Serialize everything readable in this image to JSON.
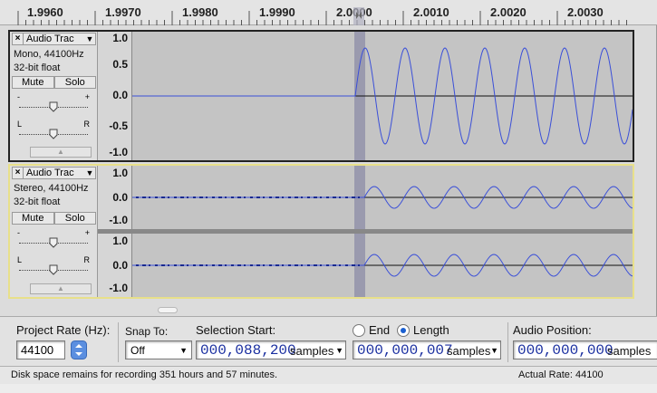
{
  "ruler": {
    "ticks": [
      "1.9960",
      "1.9970",
      "1.9980",
      "1.9990",
      "2.0000",
      "2.0010",
      "2.0020",
      "2.0030"
    ]
  },
  "tracks": [
    {
      "title": "Audio Trac",
      "format": "Mono, 44100Hz",
      "depth": "32-bit float",
      "mute_label": "Mute",
      "solo_label": "Solo",
      "gain_minus": "-",
      "gain_plus": "+",
      "pan_left": "L",
      "pan_right": "R",
      "channels": [
        {
          "ticks": [
            "1.0",
            "0.5",
            "0.0",
            "-0.5",
            "-1.0"
          ]
        }
      ]
    },
    {
      "title": "Audio Trac",
      "format": "Stereo, 44100Hz",
      "depth": "32-bit float",
      "mute_label": "Mute",
      "solo_label": "Solo",
      "gain_minus": "-",
      "gain_plus": "+",
      "pan_left": "L",
      "pan_right": "R",
      "channels": [
        {
          "ticks": [
            "1.0",
            "0.0",
            "-1.0"
          ]
        },
        {
          "ticks": [
            "1.0",
            "0.0",
            "-1.0"
          ]
        }
      ]
    }
  ],
  "selection_bar": {
    "project_rate_label": "Project Rate (Hz):",
    "project_rate_value": "44100",
    "snap_to_label": "Snap To:",
    "snap_to_value": "Off",
    "selection_start_label": "Selection Start:",
    "selection_start_value": "000,088,200",
    "selection_start_unit": "samples",
    "end_label": "End",
    "length_label": "Length",
    "length_selected": true,
    "length_value": "000,000,007",
    "length_unit": "samples",
    "audio_position_label": "Audio Position:",
    "audio_position_value": "000,000,000",
    "audio_position_unit": "samples"
  },
  "status": {
    "disk_space": "Disk space remains for recording 351 hours and 57 minutes.",
    "actual_rate": "Actual Rate: 44100"
  },
  "colors": {
    "waveform": "#3a4fd8",
    "selection_band": "#9a9aae",
    "track_background": "#c4c4c4",
    "selected_track_border": "#e8e08a"
  }
}
